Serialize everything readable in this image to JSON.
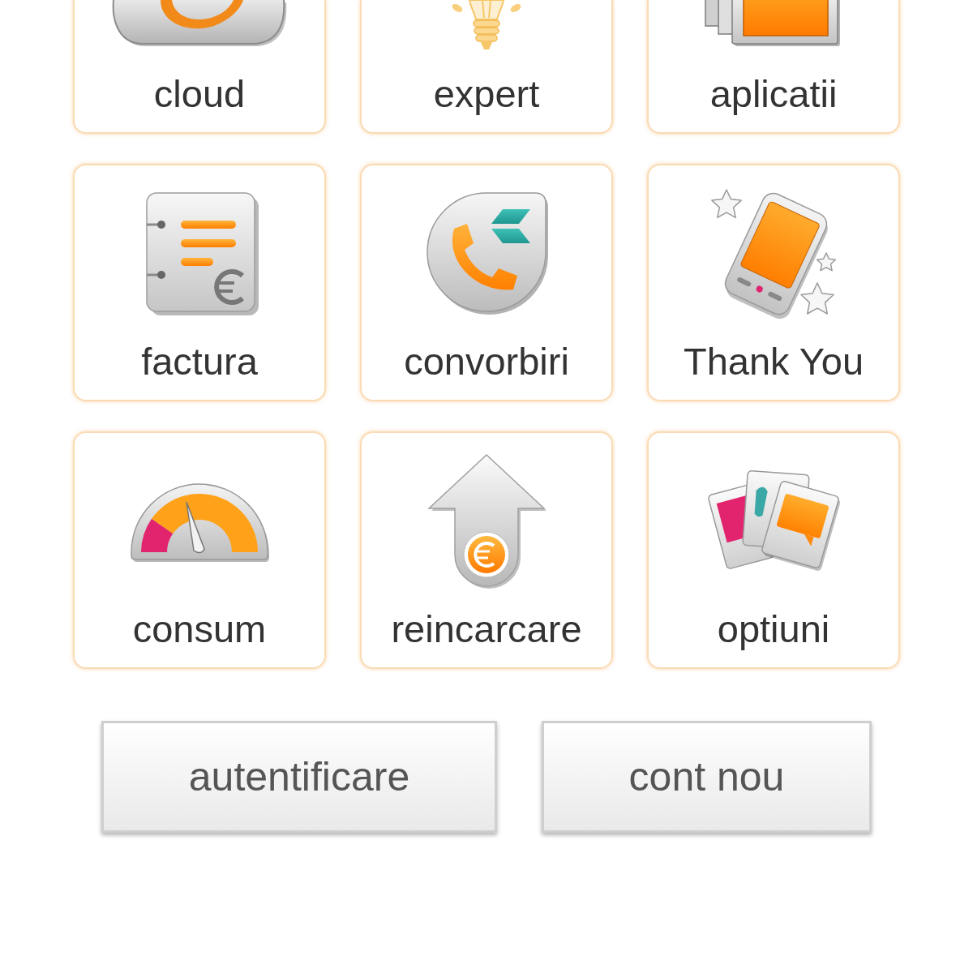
{
  "tiles": [
    {
      "label": "cloud"
    },
    {
      "label": "expert"
    },
    {
      "label": "aplicatii"
    },
    {
      "label": "factura"
    },
    {
      "label": "convorbiri"
    },
    {
      "label": "Thank You"
    },
    {
      "label": "consum"
    },
    {
      "label": "reincarcare"
    },
    {
      "label": "optiuni"
    }
  ],
  "buttons": [
    {
      "label": "autentificare"
    },
    {
      "label": "cont nou"
    }
  ]
}
